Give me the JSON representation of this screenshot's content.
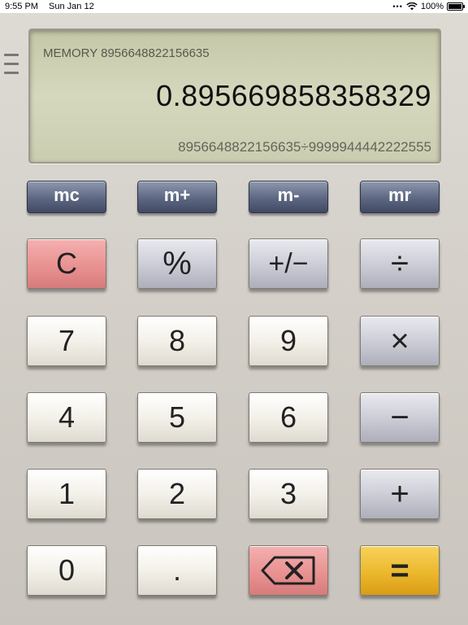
{
  "status": {
    "time": "9:55 PM",
    "date": "Sun Jan 12",
    "battery": "100%"
  },
  "display": {
    "memory_label": "MEMORY 8956648822156635",
    "value": "0.895669858358329",
    "expression": "8956648822156635÷9999944442222555"
  },
  "memory_buttons": {
    "mc": "mc",
    "mplus": "m+",
    "mminus": "m-",
    "mr": "mr"
  },
  "keys": {
    "clear": "C",
    "percent": "%",
    "plus_minus": "+/−",
    "divide": "÷",
    "seven": "7",
    "eight": "8",
    "nine": "9",
    "multiply": "×",
    "four": "4",
    "five": "5",
    "six": "6",
    "minus": "−",
    "one": "1",
    "two": "2",
    "three": "3",
    "plus": "+",
    "zero": "0",
    "decimal": ".",
    "equals": "="
  },
  "colors": {
    "clear_key": "#e88f8f",
    "backspace_key": "#e88f8f",
    "equals_key": "#eab52a",
    "memory_key": "#5d6782",
    "lcd": "#d6d8be"
  }
}
